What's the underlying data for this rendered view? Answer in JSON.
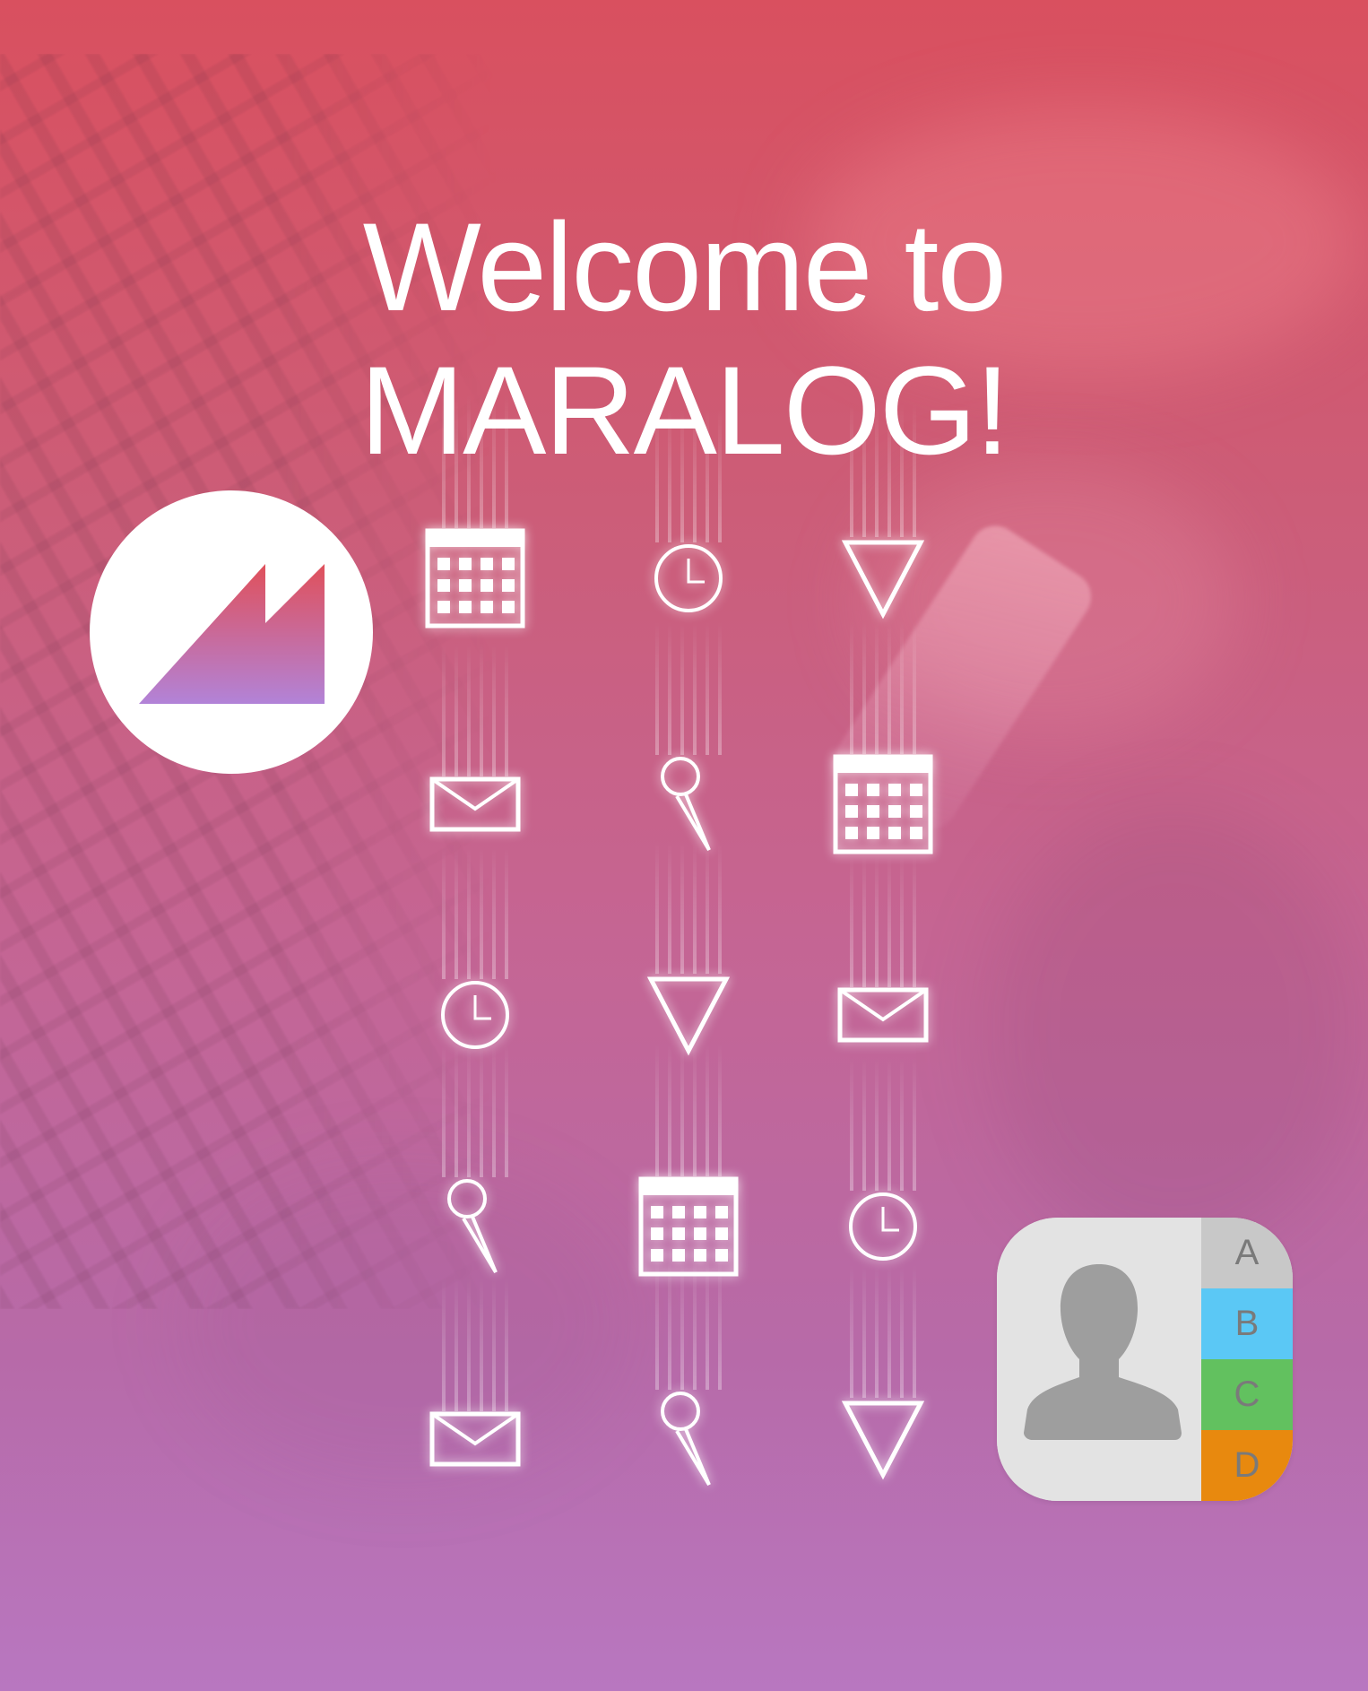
{
  "title": {
    "line1": "Welcome to",
    "line2": "MARALOG!"
  },
  "logo": {
    "name": "maralog-logo",
    "gradient_top": "#e0505a",
    "gradient_bottom": "#b283d8"
  },
  "icon_grid": [
    [
      "calendar-icon",
      "clock-icon",
      "location-arrow-icon"
    ],
    [
      "mail-icon",
      "pin-icon",
      "calendar-icon"
    ],
    [
      "clock-icon",
      "location-arrow-icon",
      "mail-icon"
    ],
    [
      "pin-icon",
      "calendar-icon",
      "clock-icon"
    ],
    [
      "mail-icon",
      "pin-icon",
      "location-arrow-icon"
    ]
  ],
  "contacts_app": {
    "tabs": [
      {
        "label": "A",
        "color": "#c8c8c8"
      },
      {
        "label": "B",
        "color": "#5bc8f5"
      },
      {
        "label": "C",
        "color": "#62c15f"
      },
      {
        "label": "D",
        "color": "#e8890e"
      }
    ],
    "silhouette_color": "#9e9e9e"
  },
  "colors": {
    "bg_top": "#d9505f",
    "bg_bottom": "#b877c0",
    "icon_stroke": "#ffffff"
  }
}
